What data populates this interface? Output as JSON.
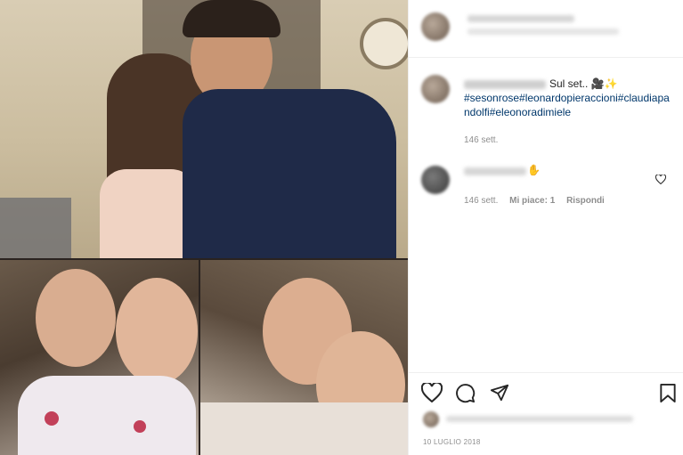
{
  "post": {
    "caption_text": "Sul set.. 🎥✨",
    "hashtags": "#sesonrose#leonardopieraccioni#claudiapandolfi#eleonoradimiele",
    "caption_time": "146 sett.",
    "comment_time": "146 sett.",
    "comment_likes": "Mi piace: 1",
    "reply_label": "Rispondi",
    "date": "10 LUGLIO 2018"
  },
  "icons": [
    "heart-icon",
    "comment-icon",
    "share-icon",
    "bookmark-icon",
    "small-heart-icon"
  ]
}
